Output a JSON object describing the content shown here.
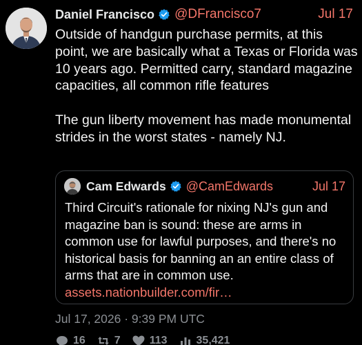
{
  "author": {
    "name": "Daniel Francisco",
    "handle": "@DFrancisco7",
    "date": "Jul 17",
    "avatar_icon": "avatar-man-in-suit"
  },
  "body": {
    "paragraph_1": "Outside of handgun purchase permits, at this point, we are basically what a Texas or Florida was 10 years ago. Permitted carry, standard magazine capacities, all common rifle features",
    "paragraph_2": "The gun liberty movement has made monumental strides in the worst states - namely NJ."
  },
  "quote": {
    "name": "Cam Edwards",
    "handle": "@CamEdwards",
    "date": "Jul 17",
    "text": "Third Circuit's rationale for nixing NJ's gun and magazine ban is sound: these are arms in common use for lawful purposes, and there's no historical basis for banning an an entire class of arms that are in common use.",
    "link": "assets.nationbuilder.com/fir…"
  },
  "timestamp": "Jul 17, 2026 · 9:39 PM UTC",
  "stats": {
    "replies": "16",
    "retweets": "7",
    "likes": "113",
    "views": "35,421"
  },
  "colors": {
    "background": "#000000",
    "accent": "#f4766a",
    "verified": "#1d9bf0",
    "muted": "#8b8f94",
    "border": "#3a3d41"
  }
}
